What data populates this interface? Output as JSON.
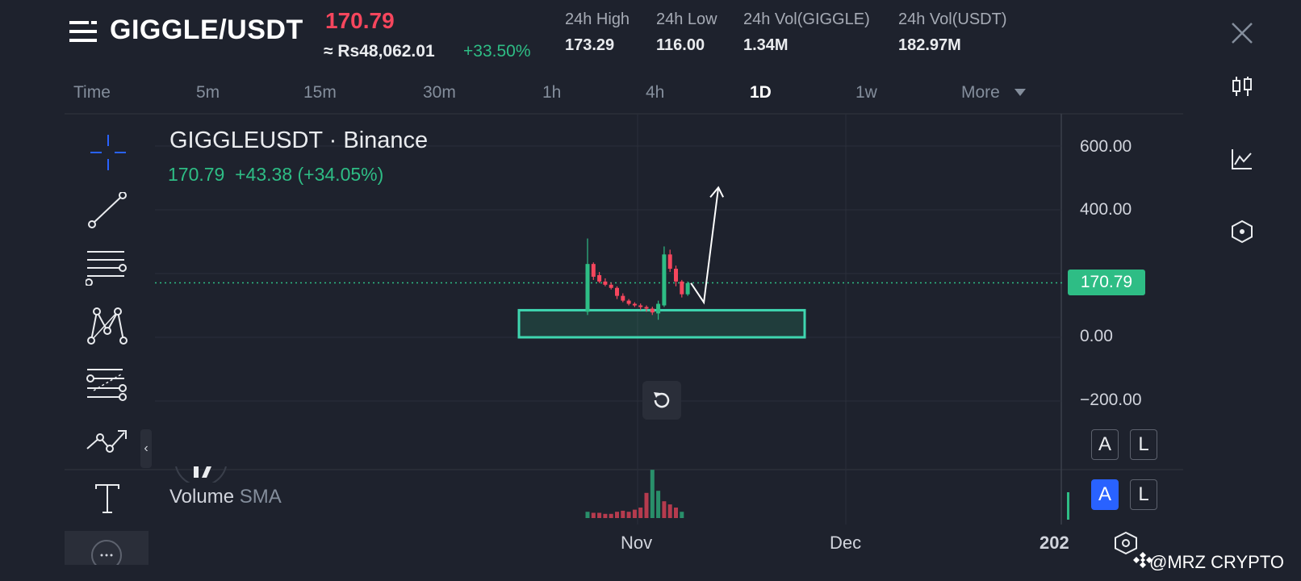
{
  "header": {
    "pair": "GIGGLE/USDT",
    "last_price": "170.79",
    "fiat_price": "≈ Rs48,062.01",
    "change_pct": "+33.50%",
    "stats": [
      {
        "label": "24h High",
        "value": "173.29"
      },
      {
        "label": "24h Low",
        "value": "116.00"
      },
      {
        "label": "24h Vol(GIGGLE)",
        "value": "1.34M"
      },
      {
        "label": "24h Vol(USDT)",
        "value": "182.97M"
      }
    ]
  },
  "timeframes": {
    "items": [
      "Time",
      "5m",
      "15m",
      "30m",
      "1h",
      "4h",
      "1D",
      "1w",
      "More"
    ],
    "active": "1D"
  },
  "chart": {
    "symbol_title": "GIGGLEUSDT · Binance",
    "ohlc_line": "170.79  +43.38 (+34.05%)",
    "current_price_tag": "170.79",
    "volume_label": "Volume",
    "volume_indicator": "SMA",
    "price_axis": [
      "600.00",
      "400.00",
      "0.00",
      "−200.00"
    ],
    "date_axis": [
      "Nov",
      "Dec",
      "202"
    ],
    "auto_scale_label": "A",
    "log_scale_label": "L",
    "colors": {
      "up": "#2ebd85",
      "down": "#f6465d",
      "accent": "#2962ff"
    }
  },
  "chart_data": {
    "type": "candlestick",
    "title": "GIGGLEUSDT · Binance",
    "ylim": [
      -200,
      600
    ],
    "y_ticks": [
      600,
      400,
      0,
      -200
    ],
    "current_price": 170.79,
    "x_ticks": [
      "Nov",
      "Dec",
      "202"
    ],
    "candles": [
      {
        "o": 80,
        "h": 310,
        "l": 70,
        "c": 230,
        "dir": "up"
      },
      {
        "o": 230,
        "h": 235,
        "l": 180,
        "c": 190,
        "dir": "down"
      },
      {
        "o": 195,
        "h": 205,
        "l": 170,
        "c": 175,
        "dir": "down"
      },
      {
        "o": 175,
        "h": 185,
        "l": 160,
        "c": 165,
        "dir": "down"
      },
      {
        "o": 165,
        "h": 172,
        "l": 150,
        "c": 155,
        "dir": "down"
      },
      {
        "o": 155,
        "h": 160,
        "l": 120,
        "c": 130,
        "dir": "down"
      },
      {
        "o": 130,
        "h": 138,
        "l": 110,
        "c": 115,
        "dir": "down"
      },
      {
        "o": 115,
        "h": 120,
        "l": 100,
        "c": 105,
        "dir": "down"
      },
      {
        "o": 105,
        "h": 110,
        "l": 95,
        "c": 100,
        "dir": "down"
      },
      {
        "o": 100,
        "h": 106,
        "l": 85,
        "c": 95,
        "dir": "down"
      },
      {
        "o": 95,
        "h": 100,
        "l": 80,
        "c": 90,
        "dir": "down"
      },
      {
        "o": 90,
        "h": 96,
        "l": 70,
        "c": 78,
        "dir": "down"
      },
      {
        "o": 75,
        "h": 115,
        "l": 55,
        "c": 105,
        "dir": "up"
      },
      {
        "o": 100,
        "h": 285,
        "l": 95,
        "c": 260,
        "dir": "up"
      },
      {
        "o": 260,
        "h": 275,
        "l": 205,
        "c": 215,
        "dir": "down"
      },
      {
        "o": 215,
        "h": 225,
        "l": 160,
        "c": 175,
        "dir": "down"
      },
      {
        "o": 175,
        "h": 180,
        "l": 125,
        "c": 135,
        "dir": "down"
      },
      {
        "o": 135,
        "h": 175,
        "l": 130,
        "c": 170,
        "dir": "up"
      }
    ],
    "volume": [
      {
        "v": 6,
        "dir": "up"
      },
      {
        "v": 5,
        "dir": "down"
      },
      {
        "v": 5,
        "dir": "down"
      },
      {
        "v": 4,
        "dir": "down"
      },
      {
        "v": 4,
        "dir": "down"
      },
      {
        "v": 6,
        "dir": "down"
      },
      {
        "v": 7,
        "dir": "down"
      },
      {
        "v": 6,
        "dir": "down"
      },
      {
        "v": 8,
        "dir": "down"
      },
      {
        "v": 10,
        "dir": "down"
      },
      {
        "v": 24,
        "dir": "down"
      },
      {
        "v": 46,
        "dir": "up"
      },
      {
        "v": 26,
        "dir": "up"
      },
      {
        "v": 16,
        "dir": "down"
      },
      {
        "v": 13,
        "dir": "down"
      },
      {
        "v": 10,
        "dir": "down"
      },
      {
        "v": 6,
        "dir": "up"
      }
    ],
    "drawings": {
      "support_zone": {
        "y_low": 0,
        "y_high": 85
      },
      "projection_arrow": {
        "from": 140,
        "to": 470
      }
    }
  },
  "toolbar": {
    "tools": [
      "crosshair-icon",
      "trendline-icon",
      "horizontal-lines-icon",
      "pattern-icon",
      "fib-icon",
      "path-icon",
      "text-icon"
    ]
  },
  "watermark": "@MRZ CRYPTO"
}
